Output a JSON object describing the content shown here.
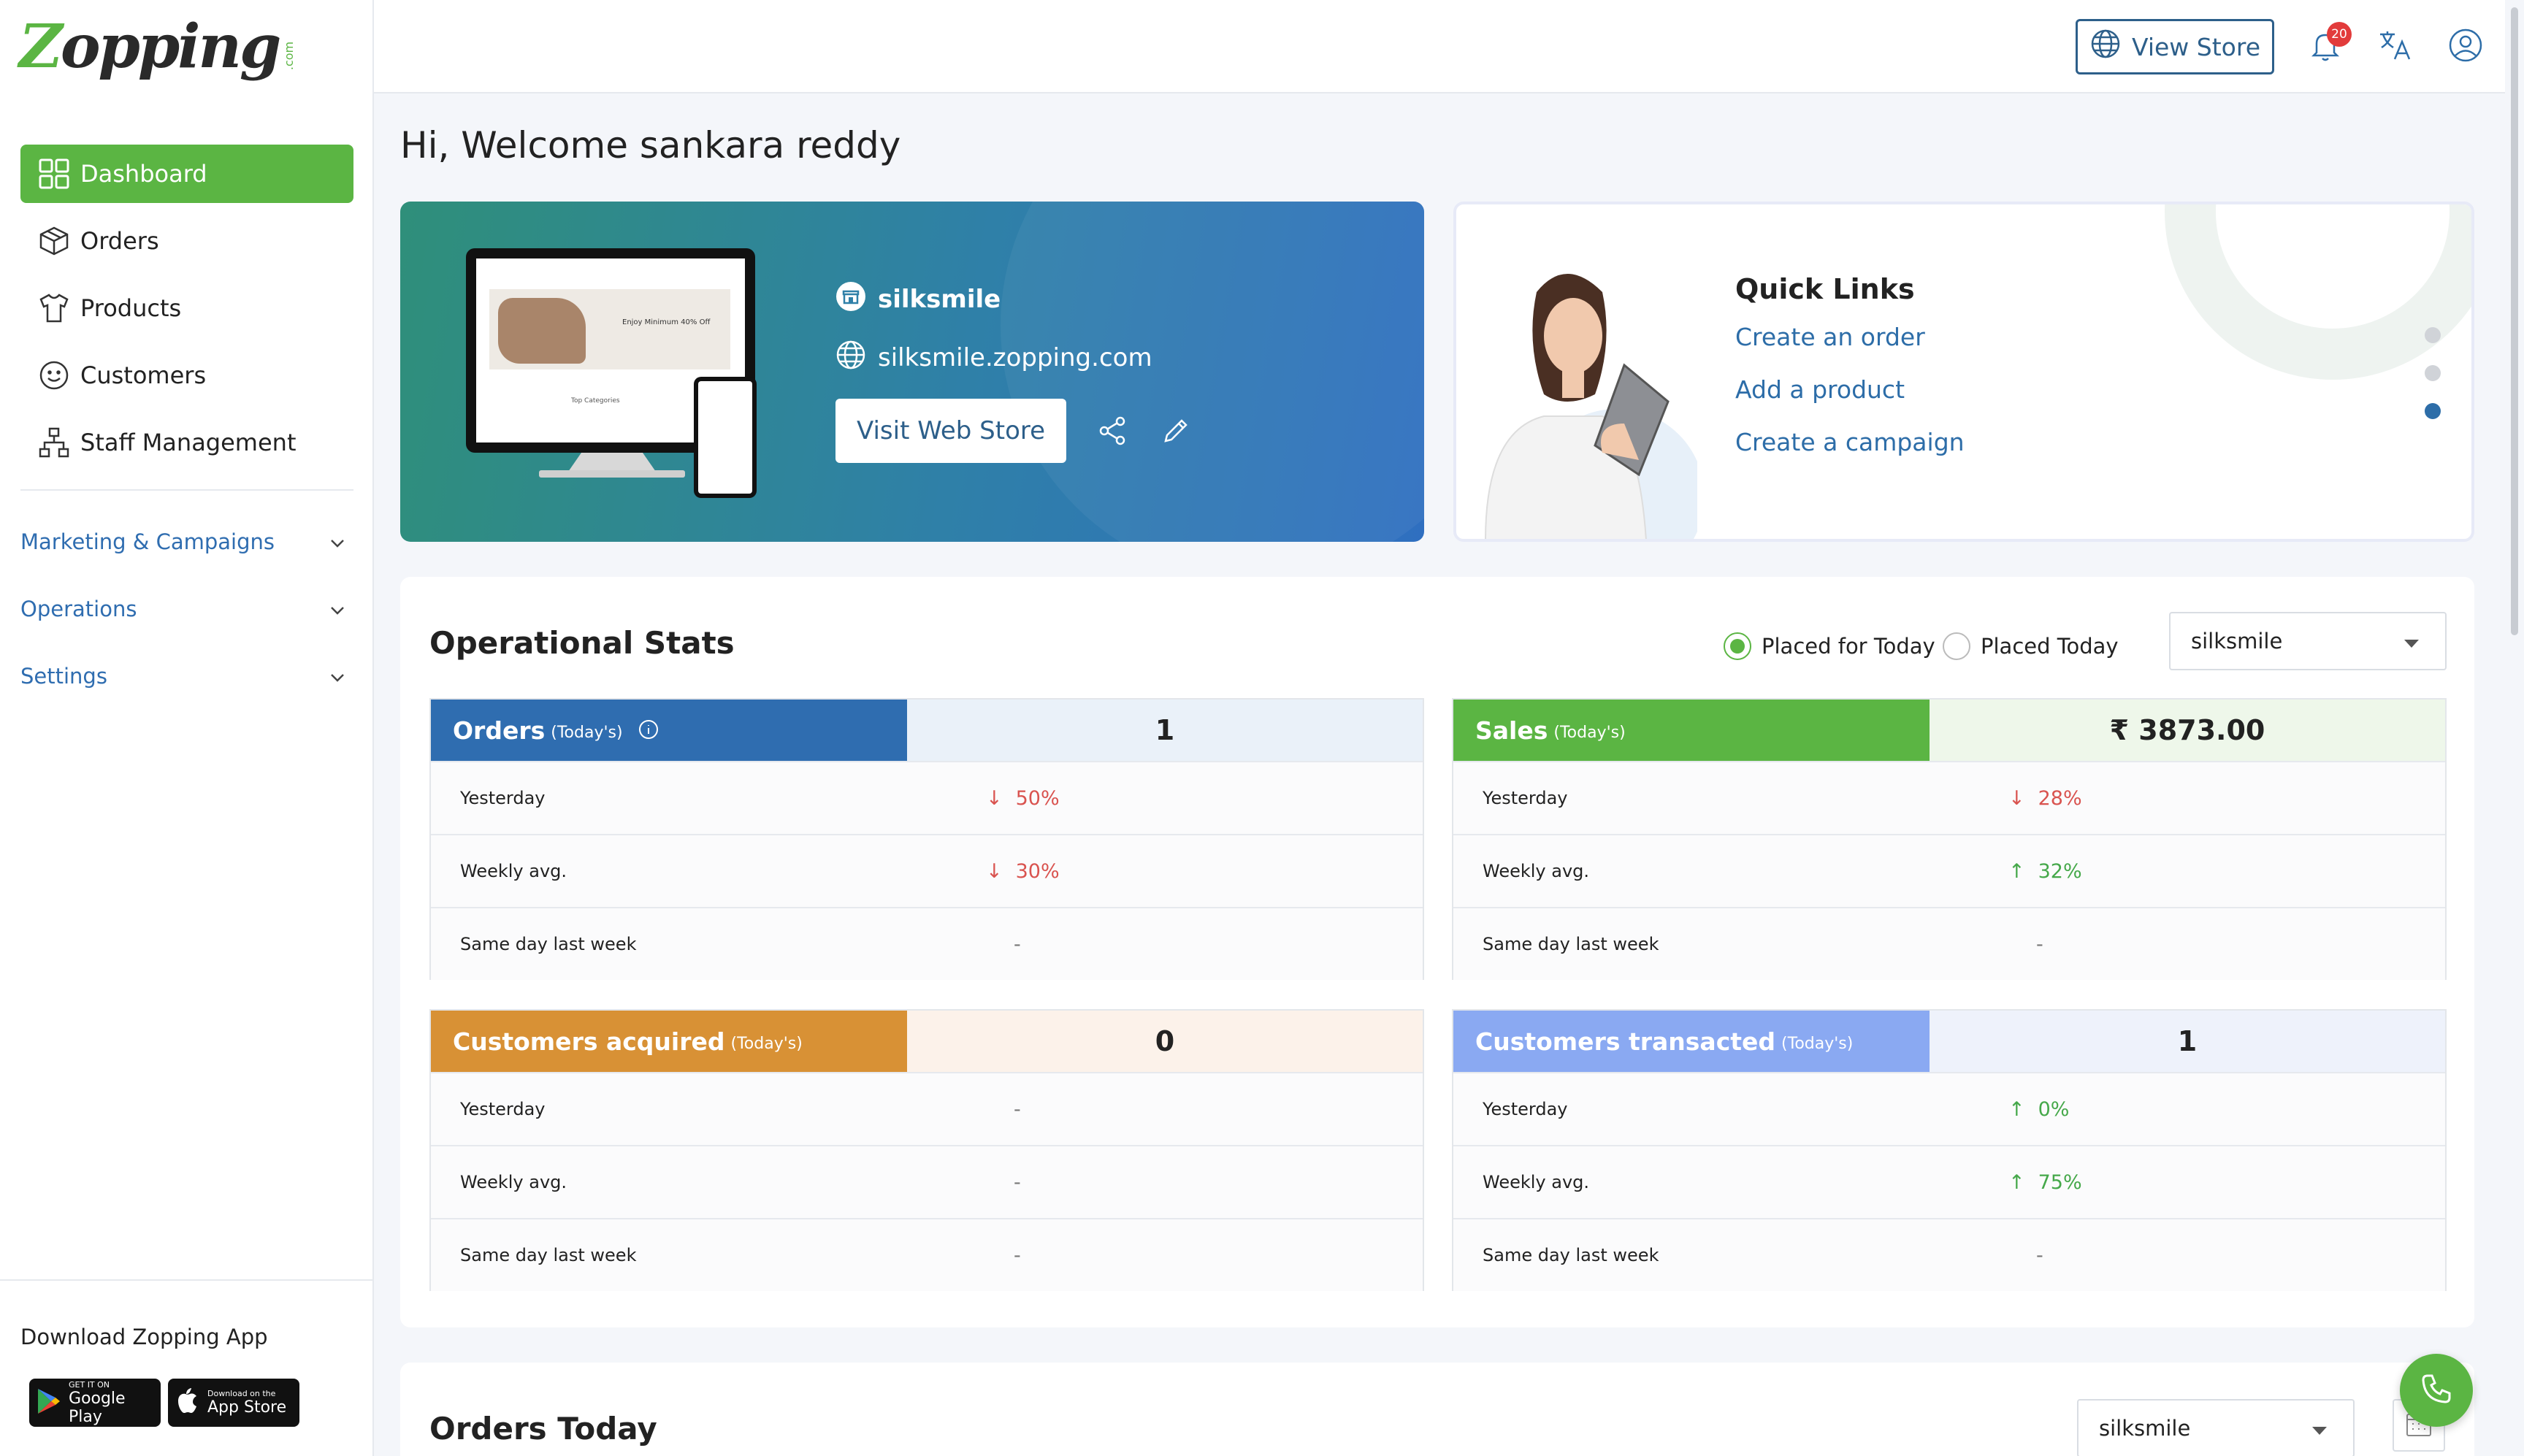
{
  "brand": {
    "logo_text": "Zopping",
    "logo_suffix": ".com",
    "accent": "#5bb543",
    "primary": "#2d6da8"
  },
  "sidebar": {
    "items": [
      {
        "label": "Dashboard",
        "icon": "dashboard-icon",
        "active": true
      },
      {
        "label": "Orders",
        "icon": "box-icon"
      },
      {
        "label": "Products",
        "icon": "shirt-icon"
      },
      {
        "label": "Customers",
        "icon": "smiley-icon"
      },
      {
        "label": "Staff Management",
        "icon": "org-chart-icon"
      }
    ],
    "groups": [
      {
        "label": "Marketing & Campaigns"
      },
      {
        "label": "Operations"
      },
      {
        "label": "Settings"
      }
    ],
    "download": {
      "title": "Download Zopping App",
      "google_small": "GET IT ON",
      "google_big": "Google Play",
      "apple_small": "Download on the",
      "apple_big": "App Store"
    }
  },
  "topbar": {
    "view_store": "View Store",
    "notification_count": "20"
  },
  "welcome": "Hi, Welcome sankara reddy",
  "hero": {
    "store_name": "silksmile",
    "store_url": "silksmile.zopping.com",
    "visit_button": "Visit Web Store",
    "promo_text": "Enjoy Minimum 40% Off",
    "categories_text": "Top Categories"
  },
  "quick_links": {
    "title": "Quick Links",
    "links": [
      "Create an order",
      "Add a product",
      "Create a campaign"
    ]
  },
  "operational_stats": {
    "title": "Operational Stats",
    "radio_options": [
      {
        "label": "Placed for Today",
        "selected": true
      },
      {
        "label": "Placed Today",
        "selected": false
      }
    ],
    "store_select": "silksmile",
    "cards": [
      {
        "label": "Orders",
        "sub": "(Today's)",
        "value": "1",
        "color": "#2f6db0",
        "value_bg": "#eaf1f9",
        "rows": [
          {
            "label": "Yesterday",
            "value": "50%",
            "trend": "down"
          },
          {
            "label": "Weekly avg.",
            "value": "30%",
            "trend": "down"
          },
          {
            "label": "Same day last week",
            "value": "-",
            "trend": "none"
          }
        ]
      },
      {
        "label": "Sales",
        "sub": "(Today's)",
        "value": "₹ 3873.00",
        "color": "#5bb543",
        "value_bg": "#eef7ea",
        "rows": [
          {
            "label": "Yesterday",
            "value": "28%",
            "trend": "down"
          },
          {
            "label": "Weekly avg.",
            "value": "32%",
            "trend": "up"
          },
          {
            "label": "Same day last week",
            "value": "-",
            "trend": "none"
          }
        ]
      },
      {
        "label": "Customers acquired",
        "sub": "(Today's)",
        "value": "0",
        "color": "#d89135",
        "value_bg": "#fcf2ea",
        "rows": [
          {
            "label": "Yesterday",
            "value": "-",
            "trend": "none"
          },
          {
            "label": "Weekly avg.",
            "value": "-",
            "trend": "none"
          },
          {
            "label": "Same day last week",
            "value": "-",
            "trend": "none"
          }
        ]
      },
      {
        "label": "Customers transacted",
        "sub": "(Today's)",
        "value": "1",
        "color": "#8aa9f2",
        "value_bg": "#eef2fb",
        "rows": [
          {
            "label": "Yesterday",
            "value": "0%",
            "trend": "up"
          },
          {
            "label": "Weekly avg.",
            "value": "75%",
            "trend": "up"
          },
          {
            "label": "Same day last week",
            "value": "-",
            "trend": "none"
          }
        ]
      }
    ]
  },
  "orders_today": {
    "title": "Orders Today",
    "store_select": "silksmile"
  }
}
